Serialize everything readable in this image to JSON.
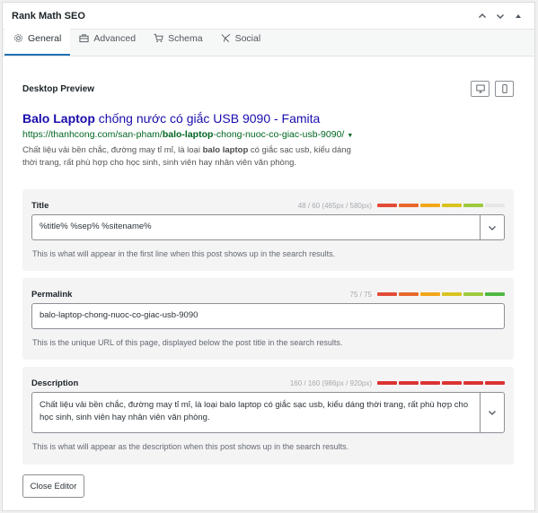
{
  "panel": {
    "title": "Rank Math SEO"
  },
  "tabs": [
    {
      "label": "General",
      "icon": "gear-icon",
      "active": true
    },
    {
      "label": "Advanced",
      "icon": "toolbox-icon"
    },
    {
      "label": "Schema",
      "icon": "cart-icon"
    },
    {
      "label": "Social",
      "icon": "social-icon"
    }
  ],
  "preview": {
    "heading": "Desktop Preview",
    "serp_title_bold": "Balo Laptop",
    "serp_title_rest": " chống nước có giắc USB 9090 - Famita",
    "serp_url_pre": "https://thanhcong.com/san-pham/",
    "serp_url_bold": "balo-laptop",
    "serp_url_post": "-chong-nuoc-co-giac-usb-9090/",
    "serp_desc_pre": "Chất liệu vải bền chắc, đường may tỉ mỉ, là loại ",
    "serp_desc_bold": "balo laptop",
    "serp_desc_post": " có giắc sạc usb, kiểu dáng thời trang, rất phù hợp cho học sinh, sinh viên hay nhân viên văn phòng."
  },
  "fields": {
    "title": {
      "label": "Title",
      "count": "48 / 60 (465px / 580px)",
      "value": "%title% %sep% %sitename%",
      "hint": "This is what will appear in the first line when this post shows up in the search results.",
      "meter": [
        "#e24a37",
        "#e9682d",
        "#f2a71b",
        "#d9c321",
        "#9fca3e",
        "#e6e6e6"
      ]
    },
    "permalink": {
      "label": "Permalink",
      "count": "75 / 75",
      "value": "balo-laptop-chong-nuoc-co-giac-usb-9090",
      "hint": "This is the unique URL of this page, displayed below the post title in the search results.",
      "meter": [
        "#e24a37",
        "#e9682d",
        "#f2a71b",
        "#d9c321",
        "#9fca3e",
        "#4fb842"
      ]
    },
    "description": {
      "label": "Description",
      "count": "160 / 160 (986px / 920px)",
      "value": "Chất liệu vải bền chắc, đường may tỉ mỉ, là loại balo laptop có giắc sạc usb, kiểu dáng thời trang, rất phù hợp cho học sinh, sinh viên hay nhân viên văn phòng.",
      "hint": "This is what will appear as the description when this post shows up in the search results.",
      "meter": [
        "#dc3232",
        "#dc3232",
        "#dc3232",
        "#dc3232",
        "#dc3232",
        "#dc3232"
      ]
    }
  },
  "buttons": {
    "close_editor": "Close Editor"
  },
  "colors": {
    "link": "#1a0dab",
    "url": "#006621",
    "accent": "#2271b1"
  }
}
